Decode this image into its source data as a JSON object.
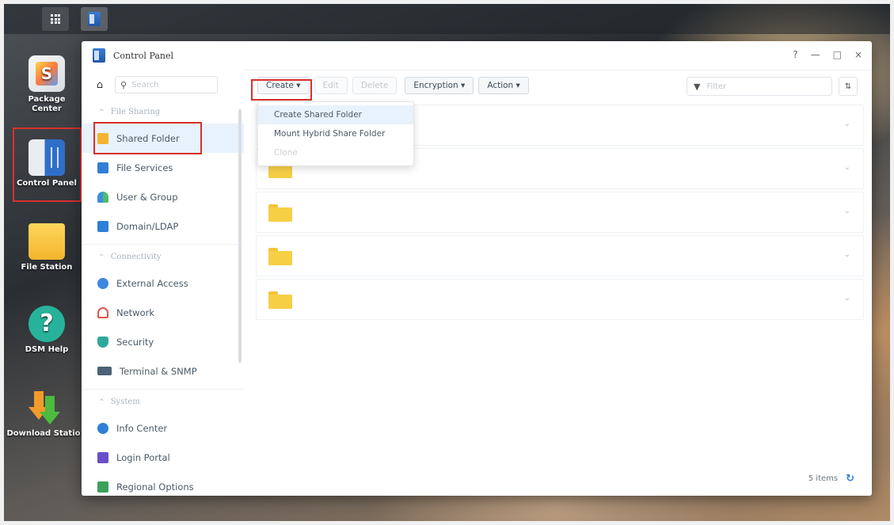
{
  "desktop": {
    "icons": [
      {
        "label_line1": "Package",
        "label_line2": "Center"
      },
      {
        "label_line1": "Control Panel",
        "label_line2": ""
      },
      {
        "label_line1": "File Station",
        "label_line2": ""
      },
      {
        "label_line1": "DSM Help",
        "label_line2": ""
      },
      {
        "label_line1": "Download Statio",
        "label_line2": ""
      }
    ]
  },
  "window": {
    "title": "Control Panel",
    "controls": {
      "help": "?",
      "minimize": "—",
      "maximize": "□",
      "close": "×"
    }
  },
  "sidebar": {
    "search_placeholder": "Search",
    "sections": [
      {
        "label": "File Sharing",
        "items": [
          "Shared Folder",
          "File Services",
          "User & Group",
          "Domain/LDAP"
        ]
      },
      {
        "label": "Connectivity",
        "items": [
          "External Access",
          "Network",
          "Security",
          "Terminal & SNMP"
        ]
      },
      {
        "label": "System",
        "items": [
          "Info Center",
          "Login Portal",
          "Regional Options"
        ]
      }
    ],
    "active_item": "Shared Folder"
  },
  "toolbar": {
    "create": "Create ▾",
    "edit": "Edit",
    "delete": "Delete",
    "encryption": "Encryption ▾",
    "action": "Action ▾",
    "filter_placeholder": "Filter"
  },
  "create_menu": {
    "items": [
      "Create Shared Folder",
      "Mount Hybrid Share Folder",
      "Clone"
    ],
    "disabled": [
      "Clone"
    ]
  },
  "list": {
    "row_count": 5
  },
  "status": {
    "items_text": "5 items"
  },
  "colors": {
    "highlight_border": "#d9302c",
    "accent": "#2d82d2",
    "folder": "#f7cf45"
  }
}
